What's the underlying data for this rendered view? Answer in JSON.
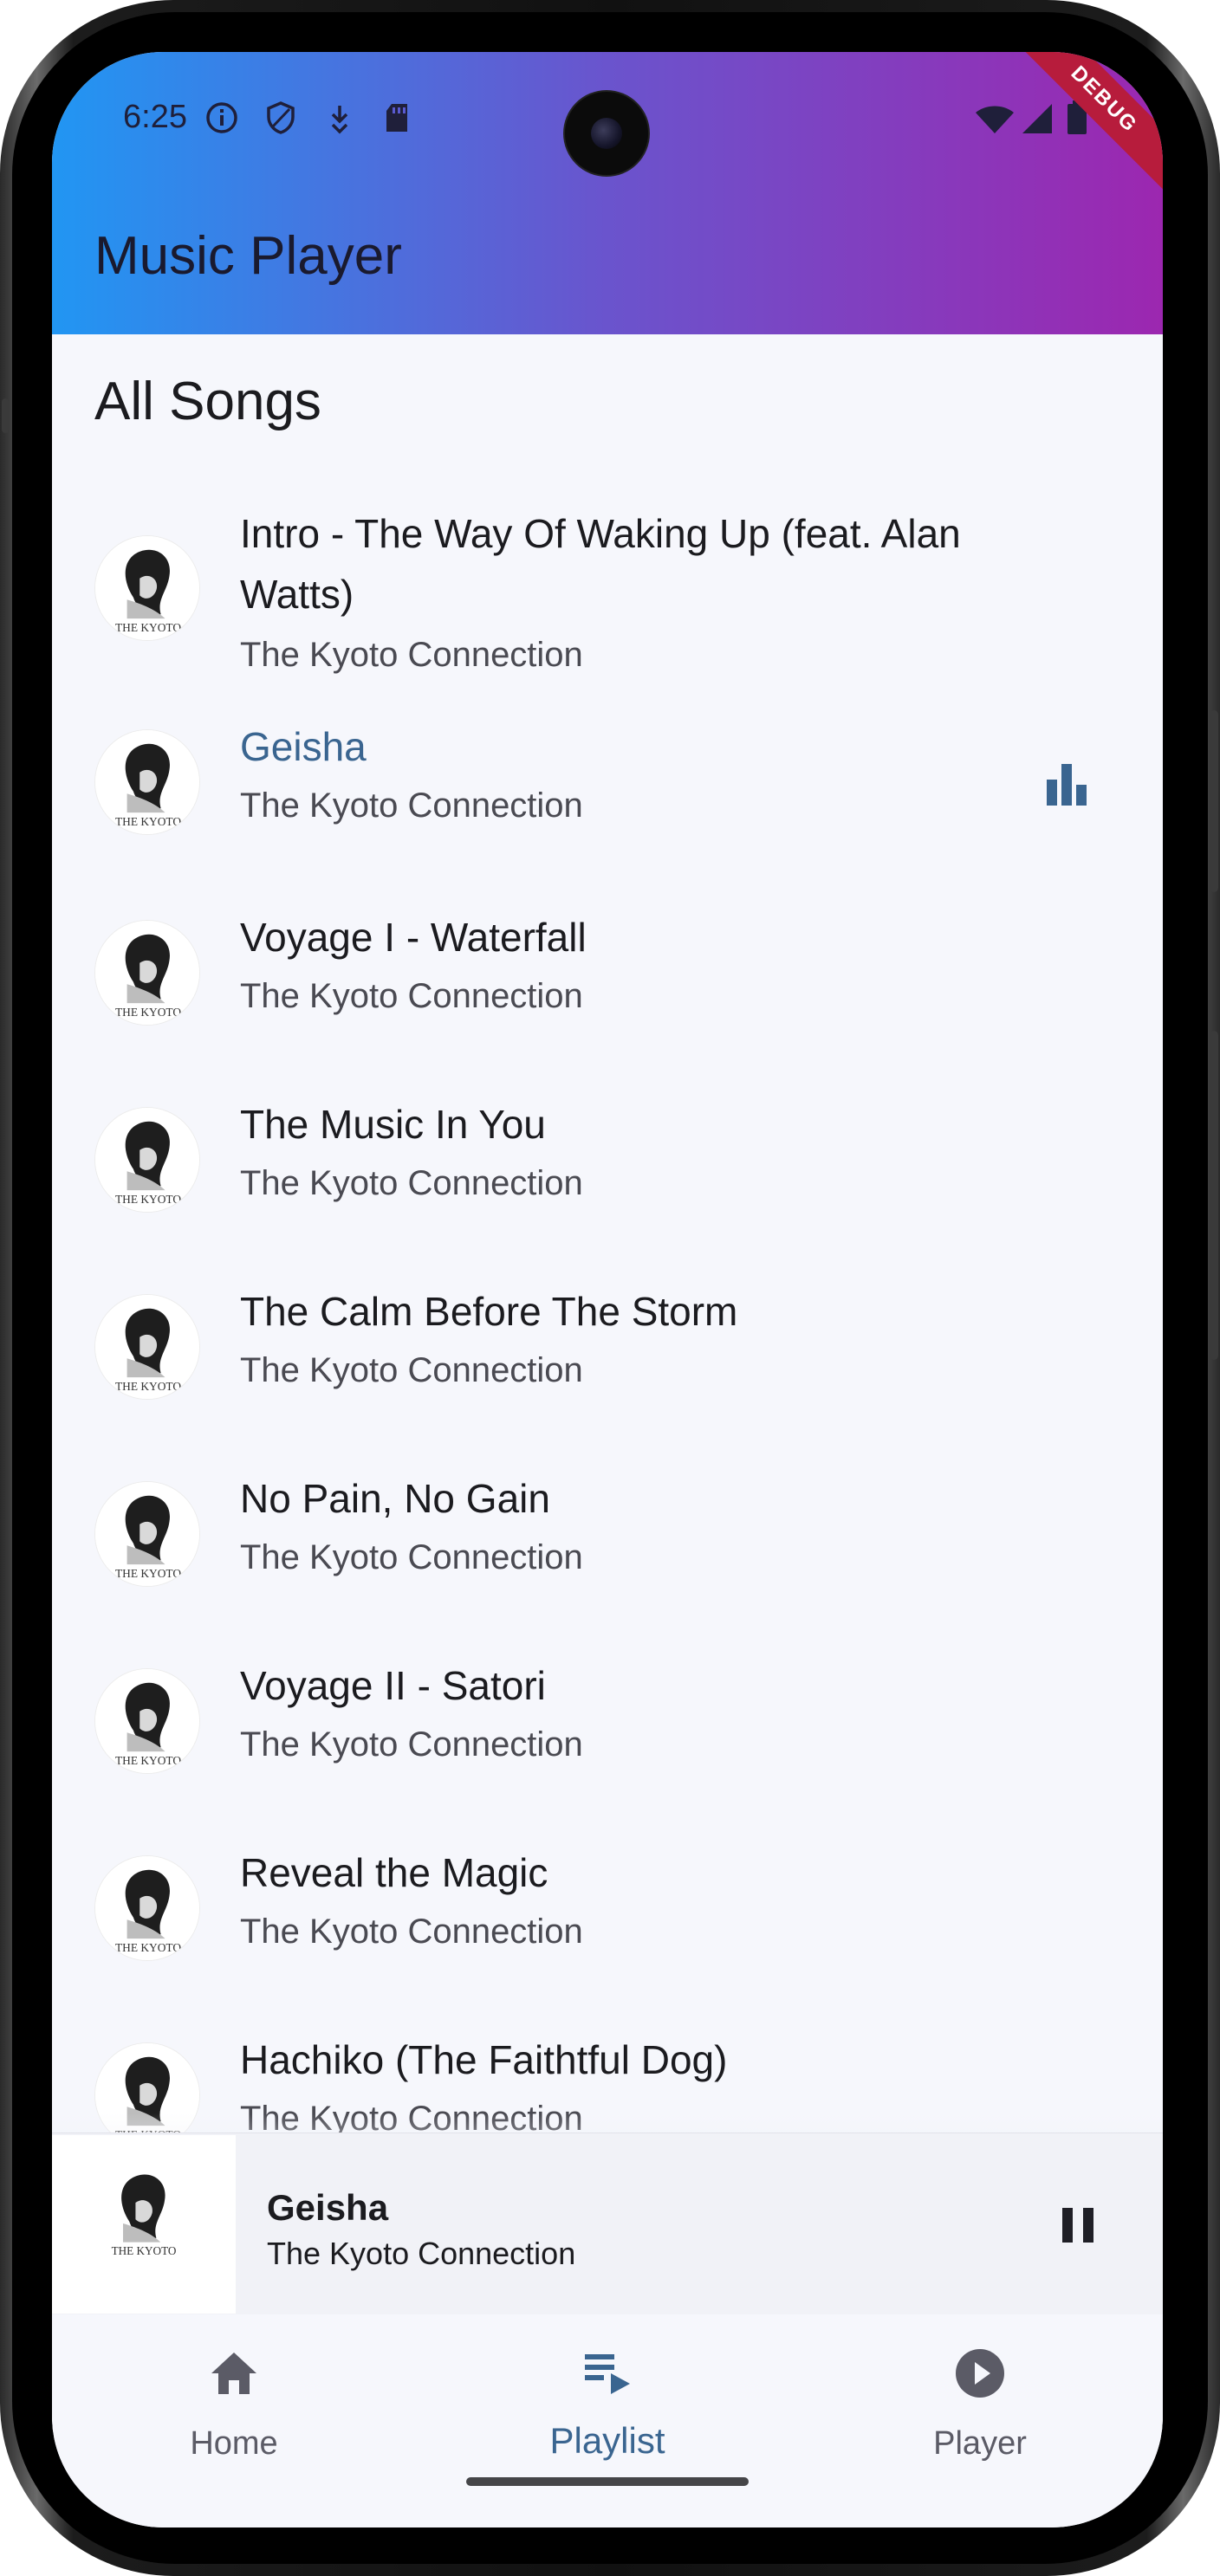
{
  "status_bar": {
    "time": "6:25",
    "left_icons": [
      "info-icon",
      "shield-icon",
      "download-icon",
      "sd-card-icon"
    ],
    "right_icons": [
      "wifi-icon",
      "signal-icon",
      "battery-icon"
    ],
    "debug_banner": "DEBUG"
  },
  "app_bar": {
    "title": "Music Player",
    "gradient": [
      "#2196f3",
      "#9c27b0"
    ]
  },
  "section": {
    "title": "All Songs"
  },
  "songs": [
    {
      "title": "Intro - The Way Of Waking Up (feat. Alan",
      "title_line2": "Watts)",
      "artist": "The Kyoto Connection"
    },
    {
      "title": "Geisha",
      "artist": "The Kyoto Connection",
      "playing": true
    },
    {
      "title": "Voyage I - Waterfall",
      "artist": "The Kyoto Connection"
    },
    {
      "title": "The Music In You",
      "artist": "The Kyoto Connection"
    },
    {
      "title": "The Calm Before The Storm",
      "artist": "The Kyoto Connection"
    },
    {
      "title": "No Pain, No Gain",
      "artist": "The Kyoto Connection"
    },
    {
      "title": "Voyage II - Satori",
      "artist": "The Kyoto Connection"
    },
    {
      "title": "Reveal the Magic",
      "artist": "The Kyoto Connection"
    },
    {
      "title": "Hachiko (The Faithtful Dog)",
      "artist": "The Kyoto Connection"
    }
  ],
  "album_art_caption": "THE KYOTO",
  "mini_player": {
    "title": "Geisha",
    "artist": "The Kyoto Connection",
    "control": "pause-icon"
  },
  "nav": {
    "items": [
      {
        "label": "Home",
        "icon": "home-icon"
      },
      {
        "label": "Playlist",
        "icon": "playlist-play-icon",
        "active": true
      },
      {
        "label": "Player",
        "icon": "play-circle-icon"
      }
    ]
  },
  "colors": {
    "accent": "#3a6590",
    "background": "#f6f7fc",
    "debug": "#b71c3c"
  }
}
